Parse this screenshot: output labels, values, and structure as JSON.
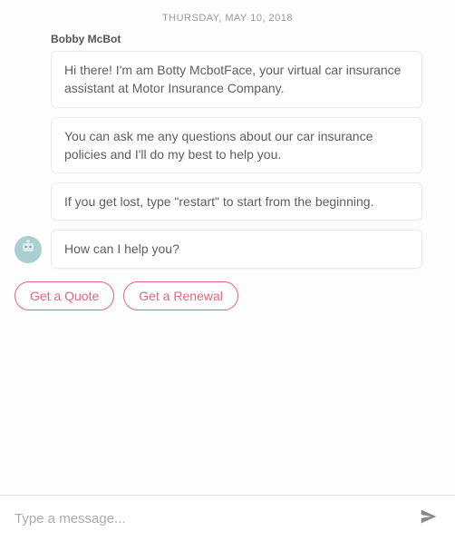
{
  "date_header": "THURSDAY, MAY 10, 2018",
  "bot_name": "Bobby McBot",
  "messages": [
    "Hi there! I'm am Botty McbotFace, your virtual car insurance assistant at Motor Insurance Company.",
    "You can ask me any questions about our car insurance policies and I'll do my best to help you.",
    "If you get lost, type \"restart\" to start from the beginning.",
    "How can I help you?"
  ],
  "quick_replies": [
    "Get a Quote",
    "Get a Renewal"
  ],
  "input": {
    "placeholder": "Type a message..."
  },
  "icons": {
    "avatar": "robot-icon",
    "send": "send-icon"
  }
}
